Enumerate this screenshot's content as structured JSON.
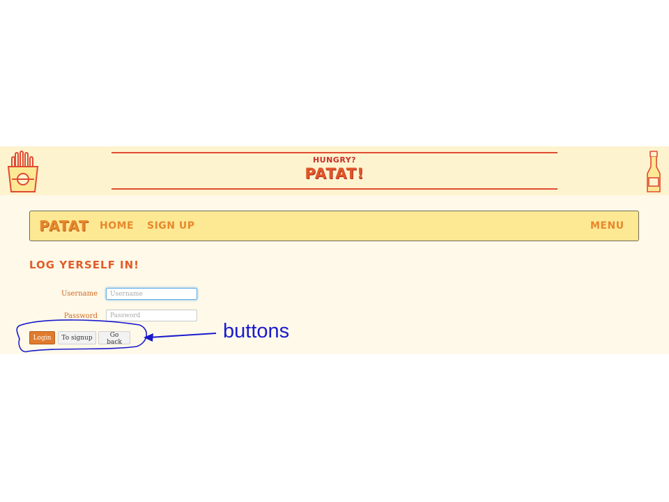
{
  "banner": {
    "tagline": "HUNGRY?",
    "brand": "PATAT!",
    "left_logo": "fries-icon",
    "right_logo": "ketchup-bottle-icon"
  },
  "navbar": {
    "brand": "PATAT",
    "links": [
      "HOME",
      "SIGN UP"
    ],
    "menu": "MENU"
  },
  "page": {
    "title": "LOG YERSELF IN!"
  },
  "form": {
    "username_label": "Username",
    "username_placeholder": "Username",
    "username_value": "",
    "password_label": "Password",
    "password_placeholder": "Password",
    "password_value": ""
  },
  "buttons": {
    "login": "Login",
    "to_signup": "To signup",
    "go_back": "Go back"
  },
  "annotation": {
    "label": "buttons"
  },
  "colors": {
    "banner_bg": "#fef3cf",
    "page_bg": "#fef9e9",
    "navbar_bg": "#fde894",
    "accent_orange": "#e7882b",
    "accent_red": "#e04a32",
    "annotation_blue": "#1a1acd"
  }
}
